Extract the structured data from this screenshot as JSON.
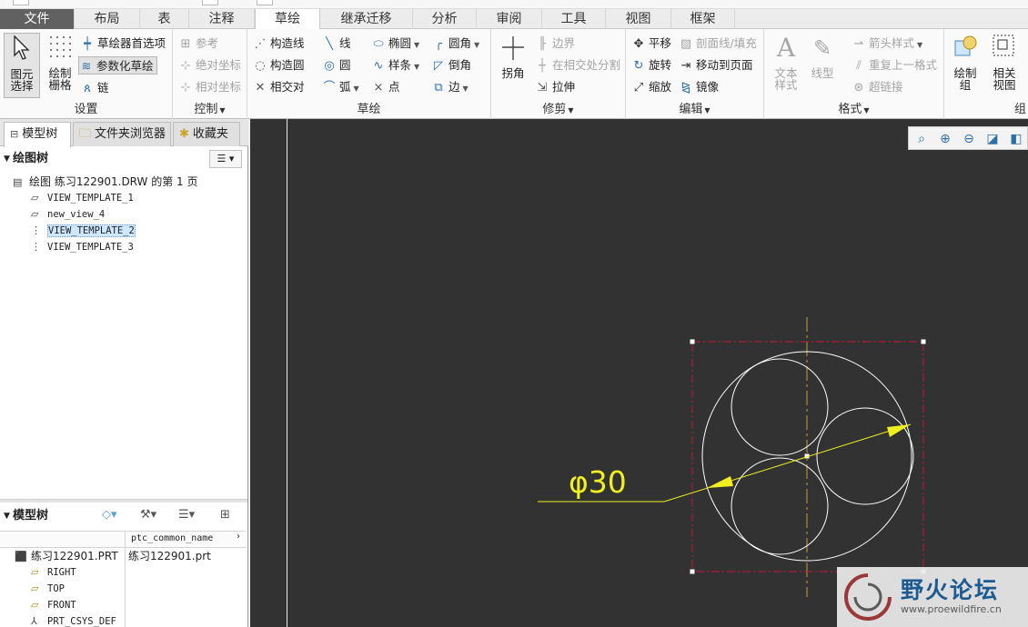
{
  "tabs": [
    "文件",
    "布局",
    "表",
    "注释",
    "草绘",
    "继承迁移",
    "分析",
    "审阅",
    "工具",
    "视图",
    "框架"
  ],
  "active_tab": "草绘",
  "ribbon": {
    "settings": {
      "label": "设置",
      "select_button": "图元选择",
      "grid_button": "绘制栅格",
      "sketcher_prefs": "草绘器首选项",
      "parametric_sketch": "参数化草绘",
      "chain": "链"
    },
    "control": {
      "label": "控制",
      "reference": "参考",
      "absolute_coords": "绝对坐标",
      "relative_coords": "相对坐标"
    },
    "sketch": {
      "label": "草绘",
      "construction_line": "构造线",
      "construction_circle": "构造圆",
      "intersection": "相交对",
      "line": "线",
      "circle": "圆",
      "arc": "弧",
      "ellipse": "椭圆",
      "spline": "样条",
      "point": "点",
      "fillet": "圆角",
      "chamfer": "倒角",
      "edge": "边"
    },
    "trim": {
      "label": "修剪",
      "corner": "拐角",
      "boundary": "边界",
      "divide_at_intersection": "在相交处分割",
      "stretch": "拉伸"
    },
    "edit": {
      "label": "编辑",
      "translate": "平移",
      "rotate": "旋转",
      "scale": "缩放",
      "hatch_fill": "剖面线/填充",
      "move_to_page": "移动到页面",
      "mirror": "镜像"
    },
    "format": {
      "label": "格式",
      "text_style": "文本样式",
      "line_style": "线型",
      "arrow_style": "箭头样式",
      "repeat_format": "重复上一格式",
      "hyperlink": "超链接"
    },
    "group": {
      "draw_group": "绘制组",
      "related_view": "相关视图",
      "more_label": "组"
    }
  },
  "left_panel": {
    "nav_tabs": [
      "模型树",
      "文件夹浏览器",
      "收藏夹"
    ],
    "drawing_tree": {
      "header": "绘图树",
      "root": "绘图 练习122901.DRW 的第 1 页",
      "items": [
        "VIEW_TEMPLATE_1",
        "new_view_4",
        "VIEW_TEMPLATE_2",
        "VIEW_TEMPLATE_3"
      ],
      "selected": "VIEW_TEMPLATE_2"
    },
    "model_tree": {
      "header": "模型树",
      "column_header": "ptc_common_name",
      "root": "练习122901.PRT",
      "root_value": "练习122901.prt",
      "items": [
        "RIGHT",
        "TOP",
        "FRONT",
        "PRT_CSYS_DEF"
      ]
    }
  },
  "canvas": {
    "dimension_text": "φ30",
    "watermark_title": "野火论坛",
    "watermark_url": "www.proewildfire.cn",
    "colors": {
      "background": "#323232",
      "geometry": "#ffffff",
      "dimension": "#f0f020",
      "selection_box": "#c8143c",
      "centerline": "#b8a24a"
    }
  }
}
